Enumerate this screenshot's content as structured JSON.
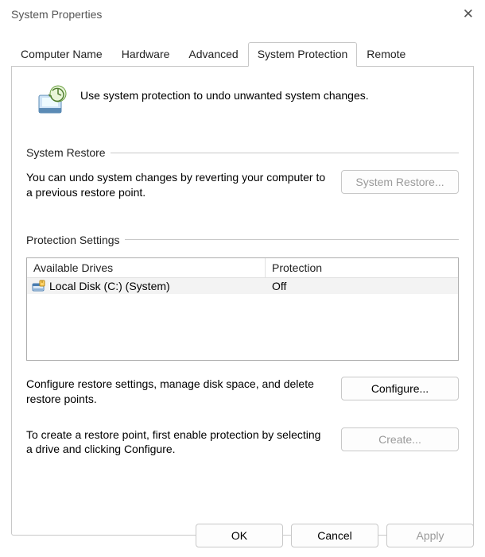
{
  "window": {
    "title": "System Properties"
  },
  "tabs": {
    "computer_name": "Computer Name",
    "hardware": "Hardware",
    "advanced": "Advanced",
    "system_protection": "System Protection",
    "remote": "Remote"
  },
  "intro": "Use system protection to undo unwanted system changes.",
  "restore": {
    "group": "System Restore",
    "desc": "You can undo system changes by reverting your computer to a previous restore point.",
    "button": "System Restore..."
  },
  "protection": {
    "group": "Protection Settings",
    "headers": {
      "drives": "Available Drives",
      "protection": "Protection"
    },
    "drives": [
      {
        "name": "Local Disk (C:) (System)",
        "status": "Off"
      }
    ],
    "configure_desc": "Configure restore settings, manage disk space, and delete restore points.",
    "configure_button": "Configure...",
    "create_desc": "To create a restore point, first enable protection by selecting a drive and clicking Configure.",
    "create_button": "Create..."
  },
  "buttons": {
    "ok": "OK",
    "cancel": "Cancel",
    "apply": "Apply"
  }
}
